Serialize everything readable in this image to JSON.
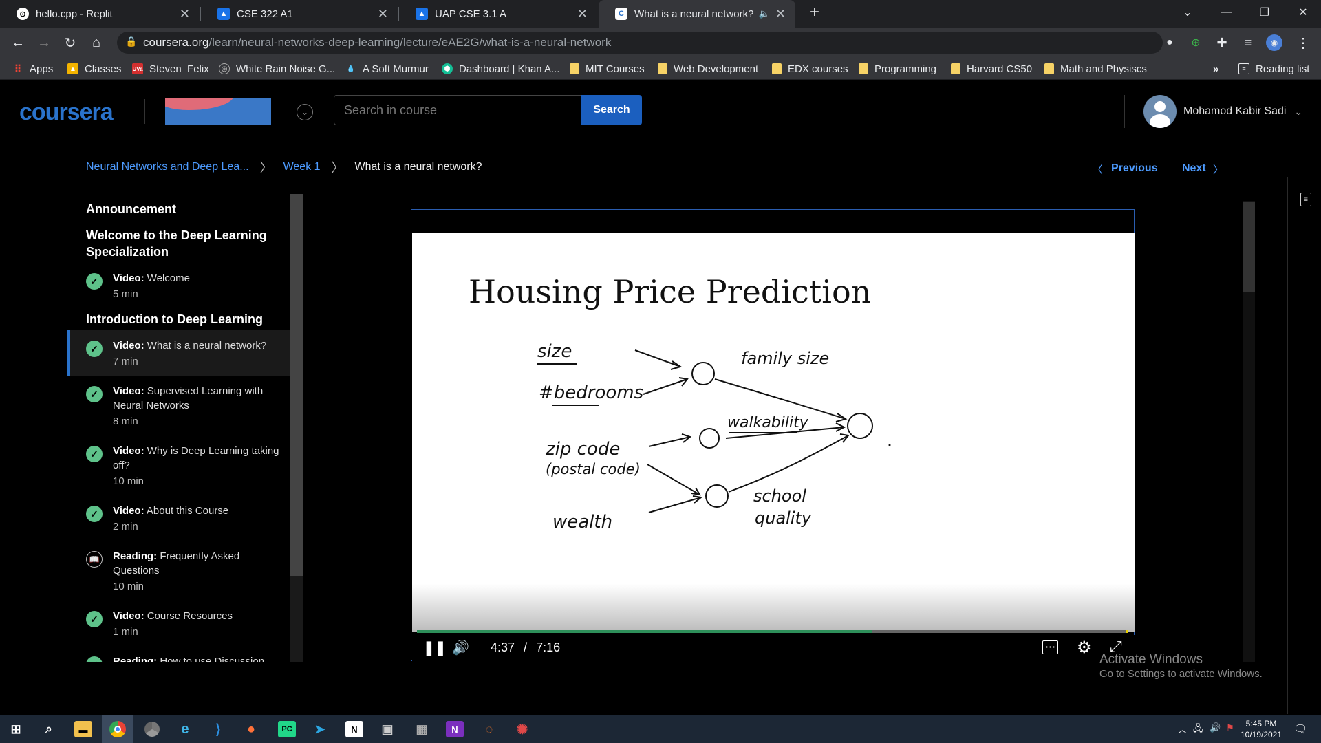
{
  "browser": {
    "tabs": [
      {
        "title": "hello.cpp - Replit",
        "favicon": "replit-icon"
      },
      {
        "title": "CSE 322 A1",
        "favicon": "classroom-icon"
      },
      {
        "title": "UAP CSE 3.1 A",
        "favicon": "classroom-icon"
      },
      {
        "title": "What is a neural network? | C",
        "favicon": "coursera-icon",
        "active": true
      }
    ],
    "url_host": "coursera.org",
    "url_path": "/learn/neural-networks-deep-learning/lecture/eAE2G/what-is-a-neural-network",
    "bookmarks": [
      "Apps",
      "Classes",
      "Steven_Felix",
      "White Rain Noise G...",
      "A Soft Murmur",
      "Dashboard | Khan A...",
      "MIT Courses",
      "Web Development",
      "EDX courses",
      "Programming",
      "Harvard CS50",
      "Math and Physiscs"
    ],
    "bookmarks_more": "»",
    "reading_list": "Reading list"
  },
  "header": {
    "logo": "coursera",
    "search_placeholder": "Search in course",
    "search_button": "Search",
    "user_name": "Mohamod Kabir Sadi"
  },
  "breadcrumb": {
    "course": "Neural Networks and Deep Lea...",
    "week": "Week 1",
    "current": "What is a neural network?"
  },
  "nav": {
    "previous": "Previous",
    "next": "Next"
  },
  "sidebar": {
    "section1": "Announcement",
    "section2": "Welcome to the Deep Learning Specialization",
    "item_welcome": {
      "type": "Video:",
      "title": "Welcome",
      "duration": "5 min"
    },
    "section3": "Introduction to Deep Learning",
    "items": [
      {
        "type": "Video:",
        "title": "What is a neural network?",
        "duration": "7 min"
      },
      {
        "type": "Video:",
        "title": "Supervised Learning with Neural Networks",
        "duration": "8 min"
      },
      {
        "type": "Video:",
        "title": "Why is Deep Learning taking off?",
        "duration": "10 min"
      },
      {
        "type": "Video:",
        "title": "About this Course",
        "duration": "2 min"
      },
      {
        "type": "Reading:",
        "title": "Frequently Asked Questions",
        "duration": "10 min"
      },
      {
        "type": "Video:",
        "title": "Course Resources",
        "duration": "1 min"
      },
      {
        "type": "Reading:",
        "title": "How to use Discussion",
        "duration": ""
      }
    ]
  },
  "video": {
    "slide_title": "Housing Price Prediction",
    "labels": {
      "size": "size",
      "bedrooms": "#bedrooms",
      "zip": "zip code",
      "postal": "(postal code)",
      "wealth": "wealth",
      "family": "family size",
      "walk": "walkability",
      "school1": "school",
      "school2": "quality"
    },
    "current_time": "4:37",
    "separator": "/",
    "duration": "7:16",
    "progress": 0.64
  },
  "watermark": {
    "line1": "Activate Windows",
    "line2": "Go to Settings to activate Windows."
  },
  "taskbar": {
    "time": "5:45 PM",
    "date": "10/19/2021"
  }
}
